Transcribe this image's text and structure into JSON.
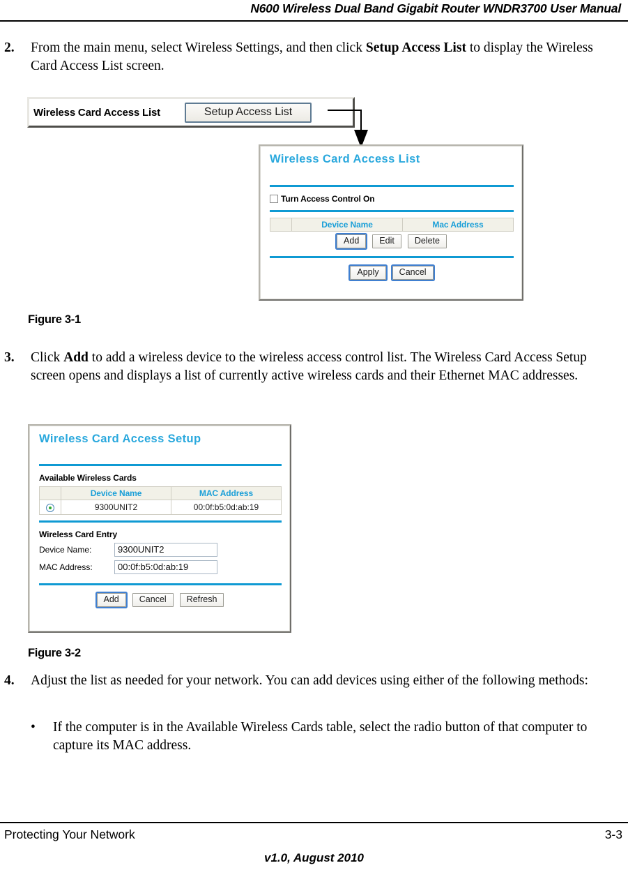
{
  "header": {
    "title": "N600 Wireless Dual Band Gigabit Router WNDR3700 User Manual"
  },
  "steps": {
    "step2": {
      "number": "2.",
      "part1": "From the main menu, select Wireless Settings, and then click ",
      "bold": "Setup Access List",
      "part2": " to display the Wireless Card Access List screen."
    },
    "step3": {
      "number": "3.",
      "part1": "Click ",
      "bold": "Add",
      "part2": " to add a wireless device to the wireless access control list. The Wireless Card Access Setup screen opens and displays a list of currently active wireless cards and their Ethernet MAC addresses."
    },
    "step4": {
      "number": "4.",
      "text": "Adjust the list as needed for your network. You can add devices using either of the following methods:"
    },
    "bullet1": {
      "mark": "•",
      "text": "If the computer is in the Available Wireless Cards table, select the radio button of that computer to capture its MAC address."
    }
  },
  "toolbar": {
    "label": "Wireless Card Access List",
    "button_label": "Setup Access List"
  },
  "figure1": {
    "caption": "Figure 3-1",
    "dialog": {
      "title": "Wireless Card Access List",
      "checkbox_label": "Turn Access Control On",
      "table": {
        "columns": [
          "",
          "Device Name",
          "Mac Address"
        ],
        "rows": []
      },
      "row_buttons": [
        "Add",
        "Edit",
        "Delete"
      ],
      "footer_buttons": [
        "Apply",
        "Cancel"
      ]
    }
  },
  "figure2": {
    "caption": "Figure 3-2",
    "dialog": {
      "title": "Wireless Card Access Setup",
      "available_label": "Available Wireless Cards",
      "table": {
        "columns": [
          "",
          "Device Name",
          "MAC Address"
        ],
        "rows": [
          {
            "selected": true,
            "device_name": "9300UNIT2",
            "mac_address": "00:0f:b5:0d:ab:19"
          }
        ]
      },
      "entry_label": "Wireless Card Entry",
      "fields": [
        {
          "label": "Device Name:",
          "value": "9300UNIT2"
        },
        {
          "label": "MAC Address:",
          "value": "00:0f:b5:0d:ab:19"
        }
      ],
      "footer_buttons": [
        "Add",
        "Cancel",
        "Refresh"
      ]
    }
  },
  "footer": {
    "left": "Protecting Your Network",
    "right": "3-3",
    "center": "v1.0, August 2010"
  },
  "colors": {
    "title_blue": "#29a8dd",
    "rule_blue": "#0f9ad3",
    "table_header_bg": "#f2f1e8",
    "radio_green": "#2faa2f",
    "focus_blue": "#3f7fd0"
  }
}
